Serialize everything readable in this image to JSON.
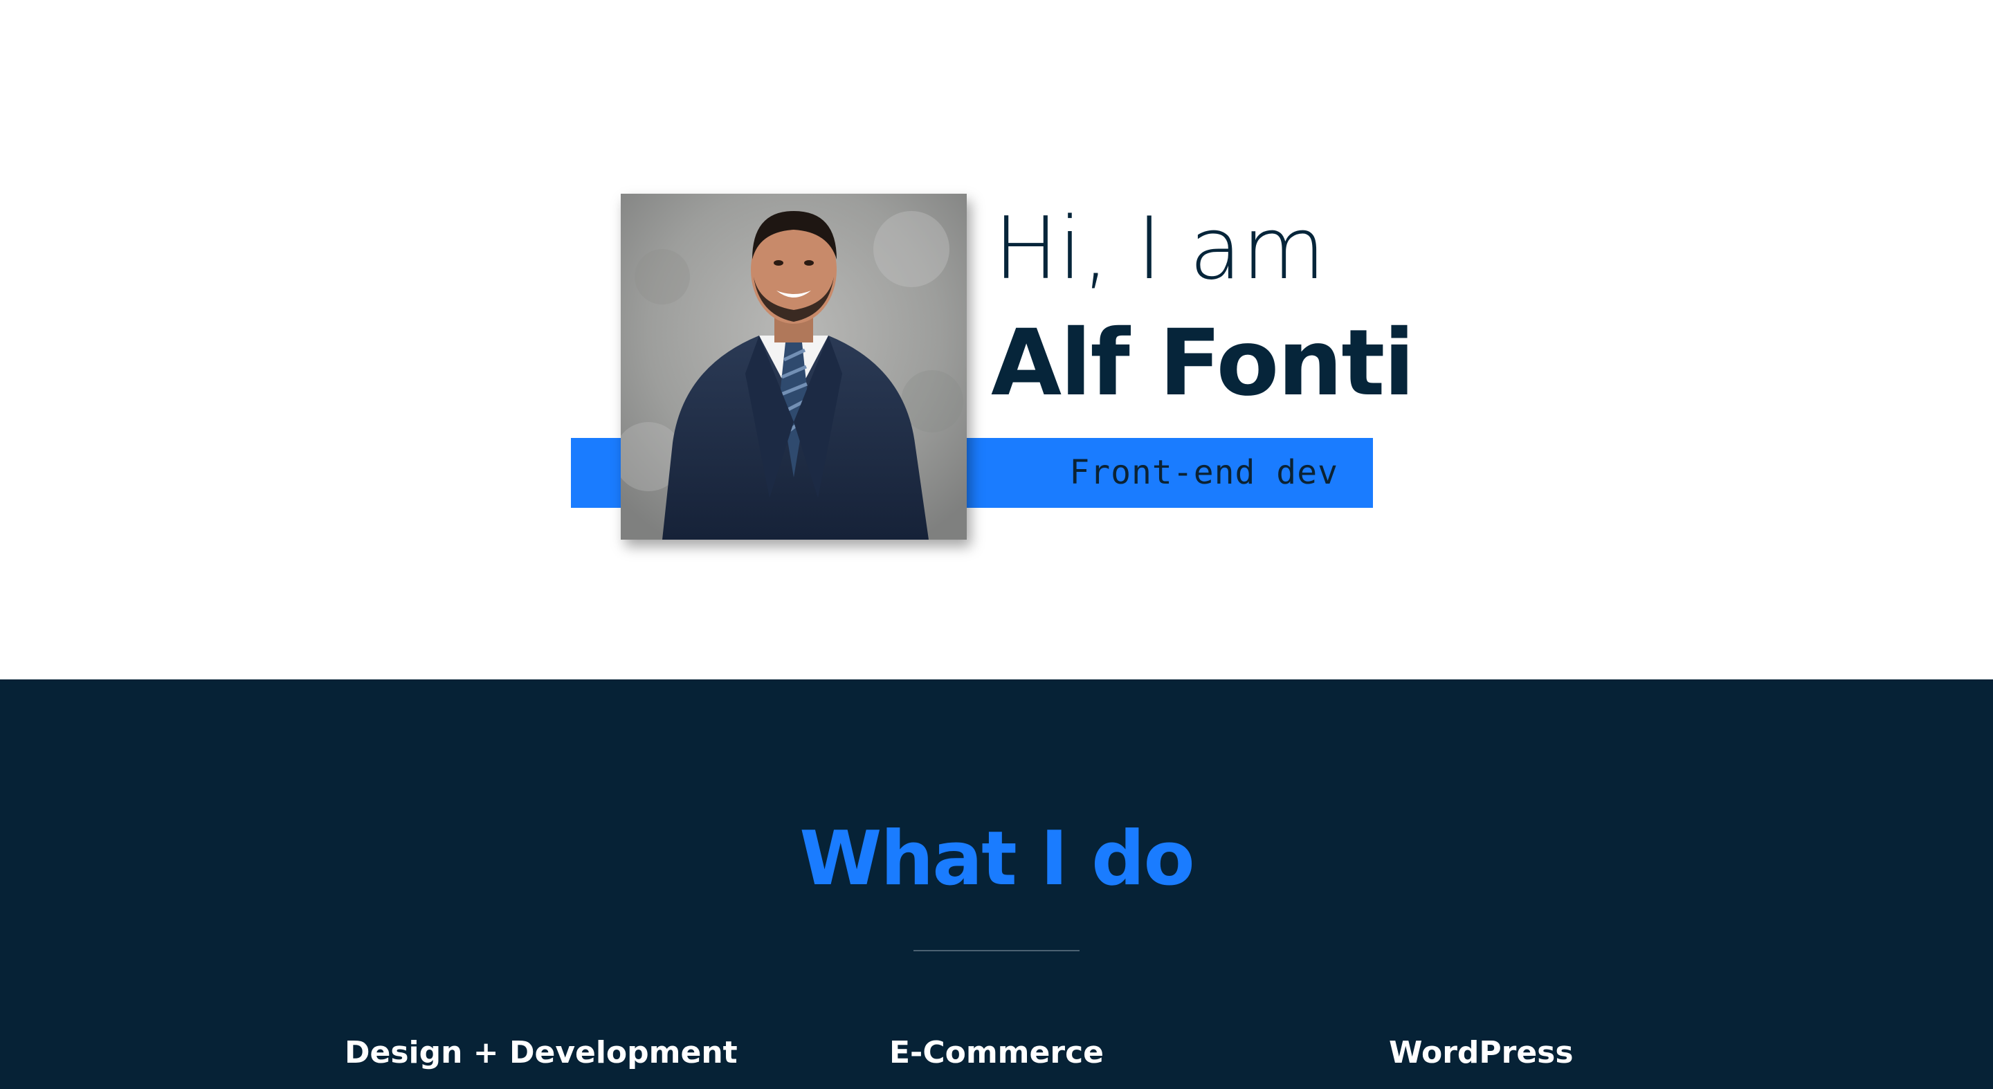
{
  "nav": {
    "menu_icon": "hamburger-menu-icon"
  },
  "hero": {
    "greeting": "Hi, I am",
    "name": "Alf Fonti",
    "role": "Front-end dev",
    "photo_alt": "Alf Fonti"
  },
  "services": {
    "title": "What I do",
    "items": [
      {
        "label": "Design + Development"
      },
      {
        "label": "E-Commerce"
      },
      {
        "label": "WordPress"
      }
    ]
  },
  "colors": {
    "accent": "#1a7cff",
    "dark": "#062236",
    "text_dark": "#06253a",
    "background": "#ffffff"
  }
}
